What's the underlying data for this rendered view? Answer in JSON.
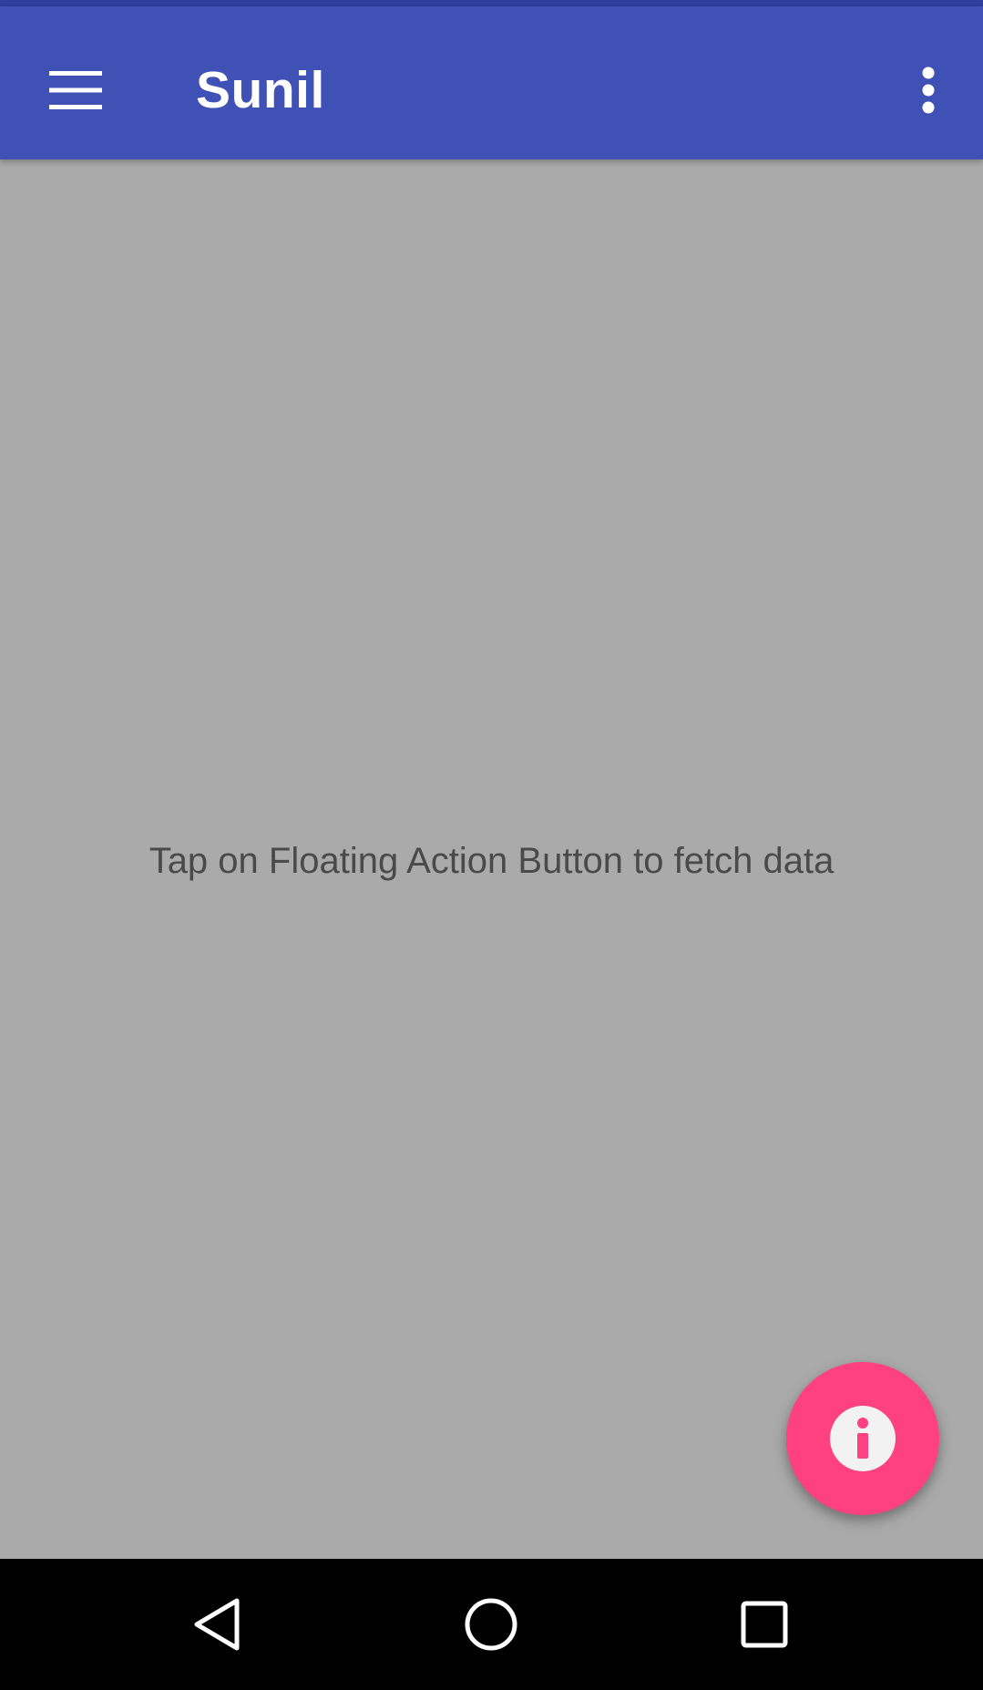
{
  "app_bar": {
    "title": "Sunil",
    "menu_icon": "hamburger-menu-icon",
    "overflow_icon": "more-vertical-icon",
    "background_color": "#3f51b5",
    "status_strip_color": "#303f9f"
  },
  "content": {
    "empty_message": "Tap on Floating Action Button to fetch data",
    "background_color": "#aaaaaa"
  },
  "fab": {
    "icon": "info-icon",
    "color": "#ff4081"
  },
  "nav_bar": {
    "back_icon": "back-triangle-icon",
    "home_icon": "home-circle-icon",
    "recents_icon": "recents-square-icon"
  }
}
